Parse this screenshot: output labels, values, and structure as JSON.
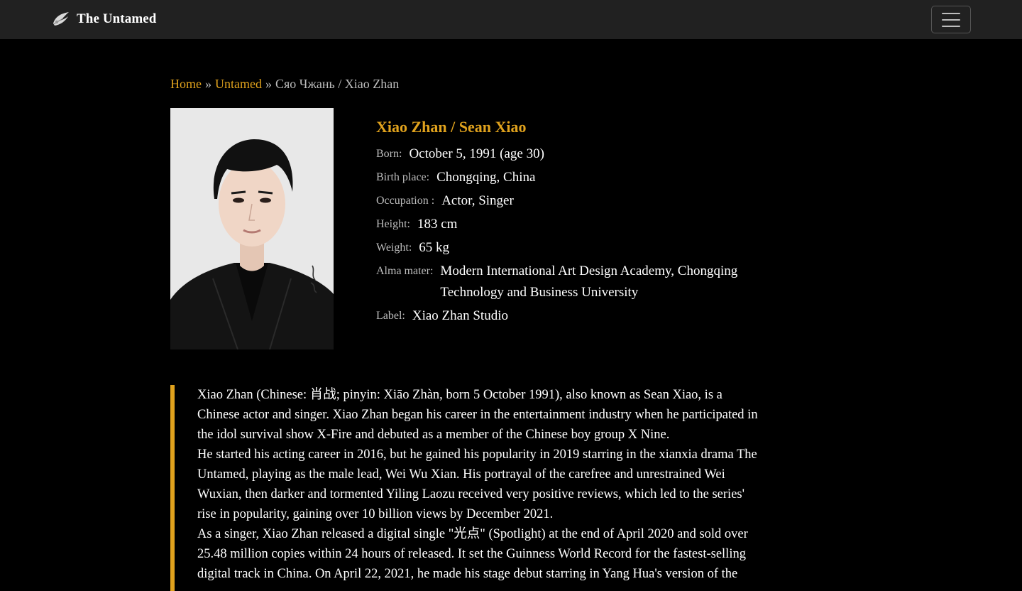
{
  "nav": {
    "brand_title": "The Untamed",
    "logo_icon": "feather-dragon-logo",
    "menu_icon": "hamburger-menu-icon"
  },
  "breadcrumb": {
    "home": "Home",
    "section": "Untamed",
    "separator": "»",
    "current": "Сяо Чжань / Xiao Zhan"
  },
  "profile": {
    "name": "Xiao Zhan / Sean Xiao",
    "rows": [
      {
        "label": "Born:",
        "value": "October 5, 1991 (age 30)"
      },
      {
        "label": "Birth place:",
        "value": "Chongqing, China"
      },
      {
        "label": "Occupation :",
        "value": "Actor, Singer"
      },
      {
        "label": "Height:",
        "value": "183 cm"
      },
      {
        "label": "Weight:",
        "value": "65 kg"
      },
      {
        "label": "Alma mater:",
        "value": "Modern International Art Design Academy, Chongqing Technology and Business University"
      },
      {
        "label": "Label:",
        "value": "Xiao Zhan Studio"
      }
    ]
  },
  "portrait": {
    "watermark": "@XTOYXZ_100591"
  },
  "bio": {
    "paragraphs": [
      "Xiao Zhan (Chinese: 肖战; pinyin: Xiāo Zhàn, born 5 October 1991), also known as Sean Xiao, is a Chinese actor and singer. Xiao Zhan began his career in the entertainment industry when he participated in the idol survival show X-Fire and debuted as a member of the Chinese boy group X Nine.",
      "He started his acting career in 2016, but he gained his popularity in 2019 starring in the xianxia drama The Untamed, playing as the male lead, Wei Wu Xian. His portrayal of the carefree and unrestrained Wei Wuxian, then darker and tormented Yiling Laozu received very positive reviews, which led to the series' rise in popularity, gaining over 10 billion views by December 2021.",
      "As a singer, Xiao Zhan released a digital single \"光点\" (Spotlight) at the end of April 2020 and sold over 25.48 million copies within 24 hours of released. It set the Guinness World Record for the fastest-selling digital track in China. On April 22, 2021, he made his stage debut starring in Yang Hua's version of the"
    ]
  },
  "colors": {
    "accent": "#e0a21d",
    "navbar": "#212121",
    "background": "#000000",
    "muted_text": "#bdbdbd"
  }
}
